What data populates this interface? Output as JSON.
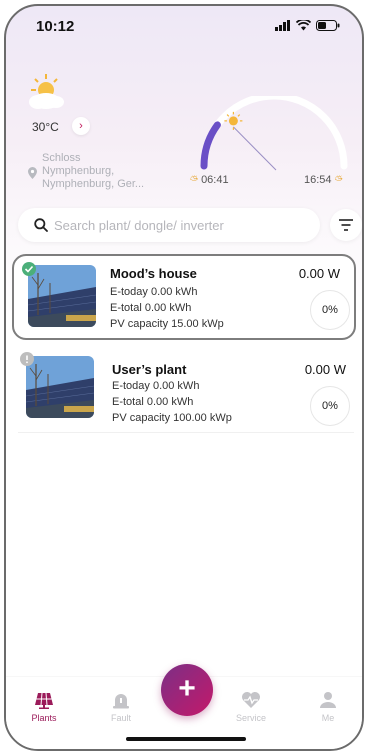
{
  "status_bar": {
    "time": "10:12"
  },
  "weather": {
    "temperature": "30°C",
    "location_line1": "Schloss",
    "location_line2": "Nymphenburg,",
    "location_line3": "Nymphenburg, Ger...",
    "sunrise": "06:41",
    "sunset": "16:54",
    "daylight_progress": 0.2
  },
  "search": {
    "placeholder": "Search plant/ dongle/ inverter"
  },
  "plants": [
    {
      "name": "Mood’s house",
      "power": "0.00 W",
      "e_today": "E-today 0.00 kWh",
      "e_total": "E-total 0.00 kWh",
      "pv_capacity": "PV capacity 15.00 kWp",
      "percent": "0%",
      "status": "online",
      "selected": true
    },
    {
      "name": "User’s plant",
      "power": "0.00 W",
      "e_today": "E-today 0.00 kWh",
      "e_total": "E-total 0.00 kWh",
      "pv_capacity": "PV capacity 100.00 kWp",
      "percent": "0%",
      "status": "offline",
      "selected": false
    }
  ],
  "tabs": [
    {
      "label": "Plants",
      "icon": "plants-icon",
      "active": true
    },
    {
      "label": "Fault",
      "icon": "fault-icon",
      "active": false
    },
    {
      "label": "Service",
      "icon": "service-icon",
      "active": false
    },
    {
      "label": "Me",
      "icon": "me-icon",
      "active": false
    }
  ],
  "colors": {
    "accent": "#9b1b5a",
    "online": "#4caf7a",
    "offline": "#bdbdbd",
    "sun_arc_active": "#6a4fc6"
  }
}
